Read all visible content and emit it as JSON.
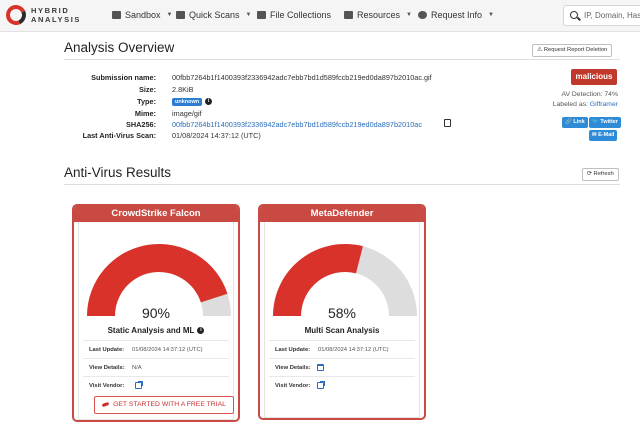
{
  "brand": {
    "line1": "HYBRID",
    "line2": "ANALYSIS"
  },
  "nav": {
    "items": [
      {
        "label": "Sandbox",
        "icon": "cube-icon",
        "dropdown": true
      },
      {
        "label": "Quick Scans",
        "icon": "pencil-icon",
        "dropdown": true
      },
      {
        "label": "File Collections",
        "icon": "files-icon",
        "dropdown": false
      },
      {
        "label": "Resources",
        "icon": "folder-icon",
        "dropdown": true
      },
      {
        "label": "Request Info",
        "icon": "question-icon",
        "dropdown": true
      }
    ],
    "search_placeholder": "IP, Domain, Hash"
  },
  "overview": {
    "title": "Analysis Overview",
    "request_deletion": "Request Report Deletion",
    "fields": {
      "submission_label": "Submission name:",
      "submission_value": "00fbb7264b1f1400393f2336942adc7ebb7bd1d589fccb219ed0da897b2010ac.gif",
      "size_label": "Size:",
      "size_value": "2.8KiB",
      "type_label": "Type:",
      "type_value": "unknown",
      "mime_label": "Mime:",
      "mime_value": "image/gif",
      "sha_label": "SHA256:",
      "sha_value": "00fbb7264b1f1400393f2336942adc7ebb7bd1d589fccb219ed0da897b2010ac",
      "scan_label": "Last Anti-Virus Scan:",
      "scan_value": "01/08/2024 14:37:12 (UTC)"
    },
    "verdict": "malicious",
    "av_detection_label": "AV Detection:",
    "av_detection_value": "74%",
    "labeled_as_label": "Labeled as:",
    "labeled_as_value": "Gifframer",
    "share": {
      "link": "Link",
      "twitter": "Twitter",
      "email": "E-Mail"
    }
  },
  "av": {
    "title": "Anti-Virus Results",
    "refresh": "Refresh",
    "cards": [
      {
        "name": "CrowdStrike Falcon",
        "percent": 90,
        "percent_label": "90%",
        "engine": "Static Analysis and ML",
        "last_update_label": "Last Update:",
        "last_update": "01/08/2024 14:37:12 (UTC)",
        "view_details_label": "View Details:",
        "view_details": "N/A",
        "visit_vendor_label": "Visit Vendor:",
        "cta": "GET STARTED WITH A FREE TRIAL"
      },
      {
        "name": "MetaDefender",
        "percent": 58,
        "percent_label": "58%",
        "engine": "Multi Scan Analysis",
        "last_update_label": "Last Update:",
        "last_update": "01/08/2024 14:37:12 (UTC)",
        "view_details_label": "View Details:",
        "visit_vendor_label": "Visit Vendor:"
      }
    ]
  },
  "colors": {
    "danger": "#d8322b",
    "gauge_bg": "#dddddd",
    "link": "#2a6ebb"
  }
}
